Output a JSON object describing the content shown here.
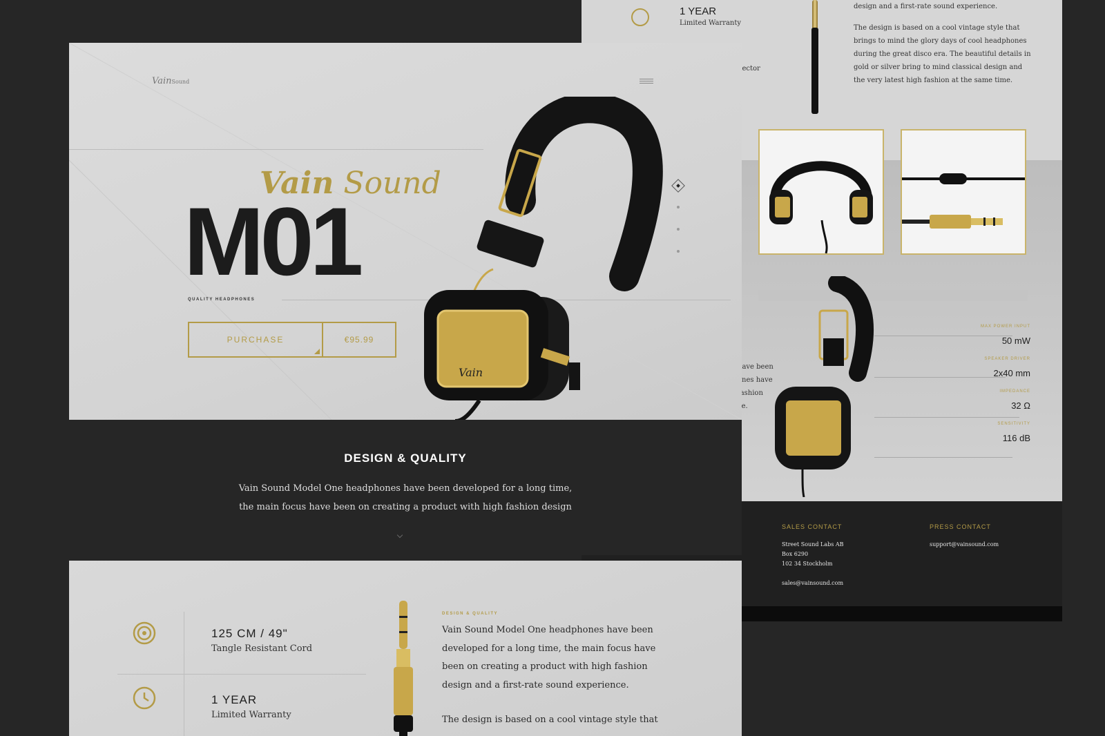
{
  "brand": {
    "logo_main": "Vain",
    "logo_sub": "Sound"
  },
  "hero": {
    "brand_word1": "Vain",
    "brand_word2": "Sound",
    "model": "M01",
    "tagline": "QUALITY HEADPHONES",
    "purchase_label": "PURCHASE",
    "price": "€95.99",
    "slide_count": 4,
    "active_slide": 1
  },
  "design_section": {
    "title": "DESIGN & QUALITY",
    "line1": "Vain Sound Model One headphones have been developed for a long time,",
    "line2": "the main focus have been on creating a product with high fashion design"
  },
  "features": [
    {
      "icon": "target-icon",
      "title": "125 CM / 49\"",
      "subtitle": "Tangle Resistant Cord"
    },
    {
      "icon": "clock-icon",
      "title": "1 YEAR",
      "subtitle": "Limited Warranty"
    }
  ],
  "detail": {
    "label": "DESIGN & QUALITY",
    "paragraph1": "Vain Sound Model One headphones have been developed for a long time, the main focus have been on creating a product with high fashion design and a first-rate sound experience.",
    "paragraph2": "The design is based on a cool vintage style that"
  },
  "back_page": {
    "feature_title": "1 YEAR",
    "feature_sub": "Limited Warranty",
    "connector_fragment": "nector",
    "text_top": "design and a first-rate sound experience.",
    "text_para": "The design is based on a cool vintage style that brings to mind the glory days of cool headphones during the great disco era. The beautiful details in gold or silver bring to mind classical design and the very latest high fashion at the same time.",
    "side_para": [
      "have been",
      "ones have",
      "fashion",
      "ce."
    ],
    "specs": [
      {
        "label": "MAX POWER INPUT",
        "value": "50 mW"
      },
      {
        "label": "SPEAKER DRIVER",
        "value": "2x40 mm"
      },
      {
        "label": "IMPEDANCE",
        "value": "32 Ω"
      },
      {
        "label": "SENSITIVITY",
        "value": "116 dB"
      }
    ],
    "sales": {
      "heading": "SALES CONTACT",
      "lines": [
        "Street Sound Labs AB",
        "Box 6290",
        "102 34 Stockholm",
        "",
        "sales@vainsound.com"
      ]
    },
    "press": {
      "heading": "PRESS CONTACT",
      "lines": [
        "support@vainsound.com"
      ]
    }
  },
  "colors": {
    "accent": "#b39b47",
    "dark": "#262626",
    "light": "#d6d6d6"
  }
}
